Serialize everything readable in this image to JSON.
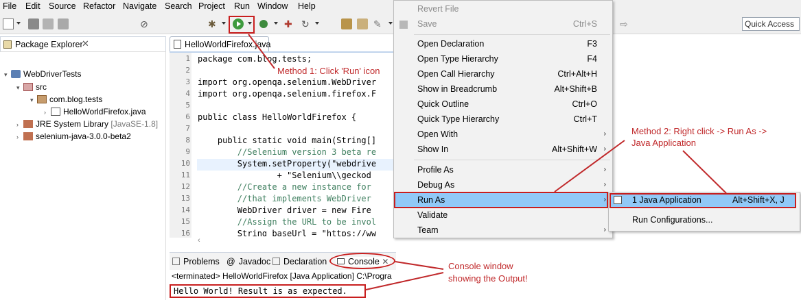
{
  "menubar": [
    "File",
    "Edit",
    "Source",
    "Refactor",
    "Navigate",
    "Search",
    "Project",
    "Run",
    "Window",
    "Help"
  ],
  "toolbar": {
    "quick_access": "Quick Access"
  },
  "package_explorer": {
    "title": "Package Explorer",
    "tree": [
      {
        "label": "WebDriverTests",
        "extra": ""
      },
      {
        "label": "src",
        "extra": ""
      },
      {
        "label": "com.blog.tests",
        "extra": ""
      },
      {
        "label": "HelloWorldFirefox.java",
        "extra": ""
      },
      {
        "label": "JRE System Library",
        "extra": "[JavaSE-1.8]"
      },
      {
        "label": "selenium-java-3.0.0-beta2",
        "extra": ""
      }
    ]
  },
  "editor": {
    "tab": "HelloWorldFirefox.java",
    "lines": [
      {
        "n": "1",
        "text": "package com.blog.tests;"
      },
      {
        "n": "2",
        "text": ""
      },
      {
        "n": "3",
        "text": "import org.openqa.selenium.WebDriver"
      },
      {
        "n": "4",
        "text": "import org.openqa.selenium.firefox.F"
      },
      {
        "n": "5",
        "text": ""
      },
      {
        "n": "6",
        "text": "public class HelloWorldFirefox {"
      },
      {
        "n": "7",
        "text": ""
      },
      {
        "n": "8",
        "text": "    public static void main(String[]"
      },
      {
        "n": "9",
        "text": "        //Selenium version 3 beta re"
      },
      {
        "n": "10",
        "text": "        System.setProperty(\"webdrive"
      },
      {
        "n": "11",
        "text": "                + \"Selenium\\\\geckod"
      },
      {
        "n": "12",
        "text": "        //Create a new instance for"
      },
      {
        "n": "13",
        "text": "        //that implements WebDriver"
      },
      {
        "n": "14",
        "text": "        WebDriver driver = new Fire"
      },
      {
        "n": "15",
        "text": "        //Assign the URL to be invol"
      },
      {
        "n": "16",
        "text": "        String baseUrl = \"https://ww"
      }
    ]
  },
  "bottom_tabs": [
    "Problems",
    "Javadoc",
    "Declaration",
    "Console"
  ],
  "console": {
    "header": "<terminated> HelloWorldFirefox [Java Application] C:\\Progra",
    "output": "Hello World! Result is as expected."
  },
  "context_menu": {
    "items": [
      {
        "label": "Revert File",
        "shortcut": "",
        "disabled": true
      },
      {
        "label": "Save",
        "shortcut": "Ctrl+S",
        "disabled": true
      },
      {
        "label": "Open Declaration",
        "shortcut": "F3"
      },
      {
        "label": "Open Type Hierarchy",
        "shortcut": "F4"
      },
      {
        "label": "Open Call Hierarchy",
        "shortcut": "Ctrl+Alt+H"
      },
      {
        "label": "Show in Breadcrumb",
        "shortcut": "Alt+Shift+B"
      },
      {
        "label": "Quick Outline",
        "shortcut": "Ctrl+O"
      },
      {
        "label": "Quick Type Hierarchy",
        "shortcut": "Ctrl+T"
      },
      {
        "label": "Open With",
        "shortcut": ""
      },
      {
        "label": "Show In",
        "shortcut": "Alt+Shift+W"
      },
      {
        "label": "Profile As",
        "shortcut": ""
      },
      {
        "label": "Debug As",
        "shortcut": ""
      },
      {
        "label": "Run As",
        "shortcut": ""
      },
      {
        "label": "Validate",
        "shortcut": ""
      },
      {
        "label": "Team",
        "shortcut": ""
      }
    ]
  },
  "submenu": {
    "items": [
      {
        "label": "1 Java Application",
        "shortcut": "Alt+Shift+X, J"
      },
      {
        "label": "Run Configurations...",
        "shortcut": ""
      }
    ]
  },
  "annotations": {
    "method1": "Method 1: Click 'Run' icon",
    "method2_line1": "Method 2: Right click -> Run As ->",
    "method2_line2": "Java Application",
    "console_line1": "Console window",
    "console_line2": "showing the Output!"
  },
  "colors": {
    "annotation": "#c0282a",
    "highlight": "#91c9f7"
  }
}
